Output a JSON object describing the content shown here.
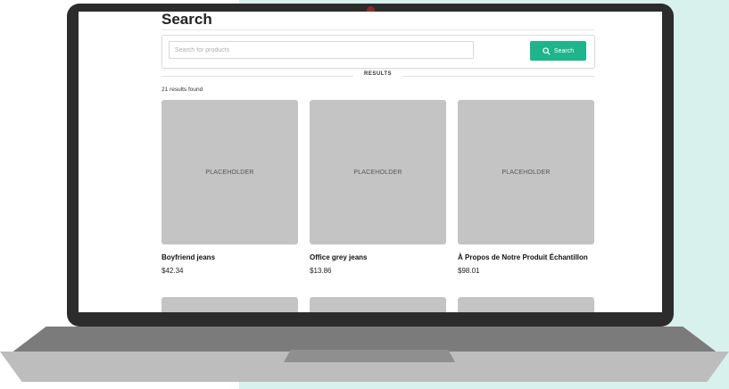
{
  "page": {
    "title": "Search",
    "search_placeholder": "Search for products",
    "search_button_label": "Search",
    "results_label": "RESULTS",
    "results_count": "21 results found"
  },
  "products": [
    {
      "name": "Boyfriend jeans",
      "price": "$42.34",
      "image_label": "PLACEHOLDER"
    },
    {
      "name": "Office grey jeans",
      "price": "$13.86",
      "image_label": "PLACEHOLDER"
    },
    {
      "name": "À Propos de Notre Produit Échantillon",
      "price": "$98.01",
      "image_label": "PLACEHOLDER"
    }
  ],
  "colors": {
    "accent": "#1fb48a",
    "background_mint": "#d8f1ec",
    "placeholder_gray": "#c4c4c4"
  },
  "icons": {
    "search_button_icon": "search-icon"
  }
}
